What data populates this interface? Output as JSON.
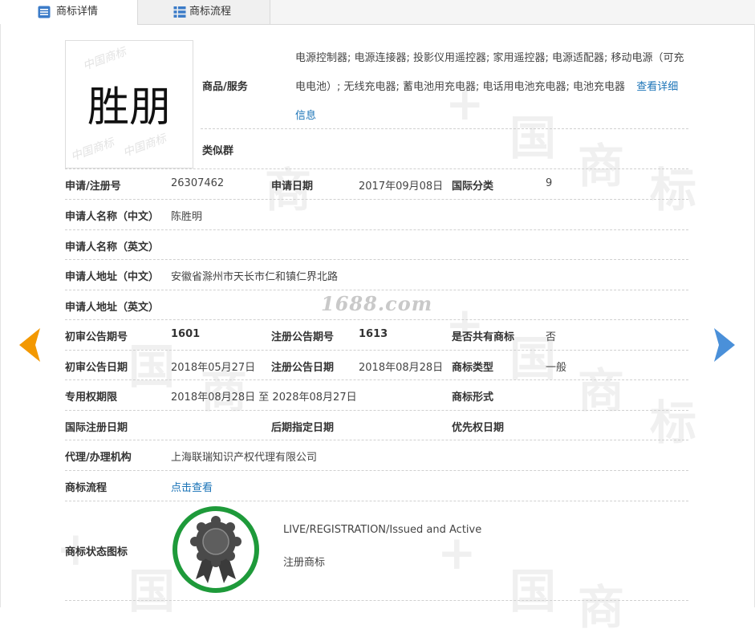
{
  "tabs": [
    {
      "label": "商标详情",
      "icon": "list-detail-icon"
    },
    {
      "label": "商标流程",
      "icon": "grid-table-icon"
    }
  ],
  "trademark": {
    "mark_text": "胜朋",
    "goods_label": "商品/服务",
    "goods_text": "电源控制器; 电源连接器; 投影仪用遥控器; 家用遥控器; 电源适配器; 移动电源（可充电电池）; 无线充电器; 蓄电池用充电器; 电话用电池充电器; 电池充电器",
    "goods_more": "查看详细信息",
    "similar_group_label": "类似群"
  },
  "rows": {
    "reg_no_label": "申请/注册号",
    "reg_no": "26307462",
    "apply_date_label": "申请日期",
    "apply_date": "2017年09月08日",
    "intl_class_label": "国际分类",
    "intl_class": "9",
    "applicant_cn_label": "申请人名称（中文）",
    "applicant_cn": "陈胜明",
    "applicant_en_label": "申请人名称（英文）",
    "address_cn_label": "申请人地址（中文）",
    "address_cn": "安徽省滁州市天长市仁和镇仁界北路",
    "address_en_label": "申请人地址（英文）",
    "prelim_no_label": "初审公告期号",
    "prelim_no": "1601",
    "reg_pub_no_label": "注册公告期号",
    "reg_pub_no": "1613",
    "shared_label": "是否共有商标",
    "shared": "否",
    "prelim_date_label": "初审公告日期",
    "prelim_date": "2018年05月27日",
    "reg_pub_date_label": "注册公告日期",
    "reg_pub_date": "2018年08月28日",
    "mark_type_label": "商标类型",
    "mark_type": "一般",
    "exclusive_label": "专用权期限",
    "exclusive": "2018年08月28日 至 2028年08月27日",
    "mark_form_label": "商标形式",
    "intl_reg_date_label": "国际注册日期",
    "later_date_label": "后期指定日期",
    "priority_date_label": "优先权日期",
    "agency_label": "代理/办理机构",
    "agency": "上海联瑞知识产权代理有限公司",
    "flow_label": "商标流程",
    "flow_link": "点击查看",
    "status_label": "商标状态图标",
    "status_en": "LIVE/REGISTRATION/Issued and Active",
    "status_cn": "注册商标"
  },
  "watermark": "1688.com",
  "nav": {
    "prev_icon": "arrow-left-icon",
    "next_icon": "arrow-right-icon"
  },
  "colors": {
    "link": "#1a73b7",
    "prev_arrow": "#f39800",
    "next_arrow": "#4a90d9",
    "seal_ring": "#1e9a3a"
  }
}
